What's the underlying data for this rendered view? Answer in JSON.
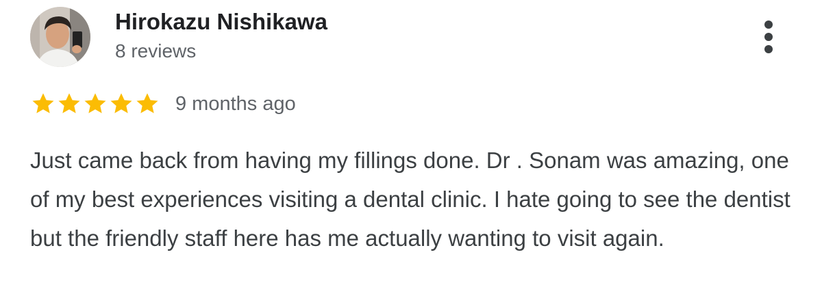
{
  "review": {
    "author": {
      "name": "Hirokazu Nishikawa",
      "reviews_count": "8 reviews",
      "avatar": "profile-photo"
    },
    "rating": 5,
    "rating_max": 5,
    "star_color": "#FBBC04",
    "time_ago": "9 months ago",
    "text": "Just came back from having my fillings done. Dr . Sonam was amazing, one of my best experiences visiting a dental clinic. I hate going to see the dentist but the friendly staff here has me actually wanting to visit again.",
    "menu_icon": "more-vert-icon"
  }
}
